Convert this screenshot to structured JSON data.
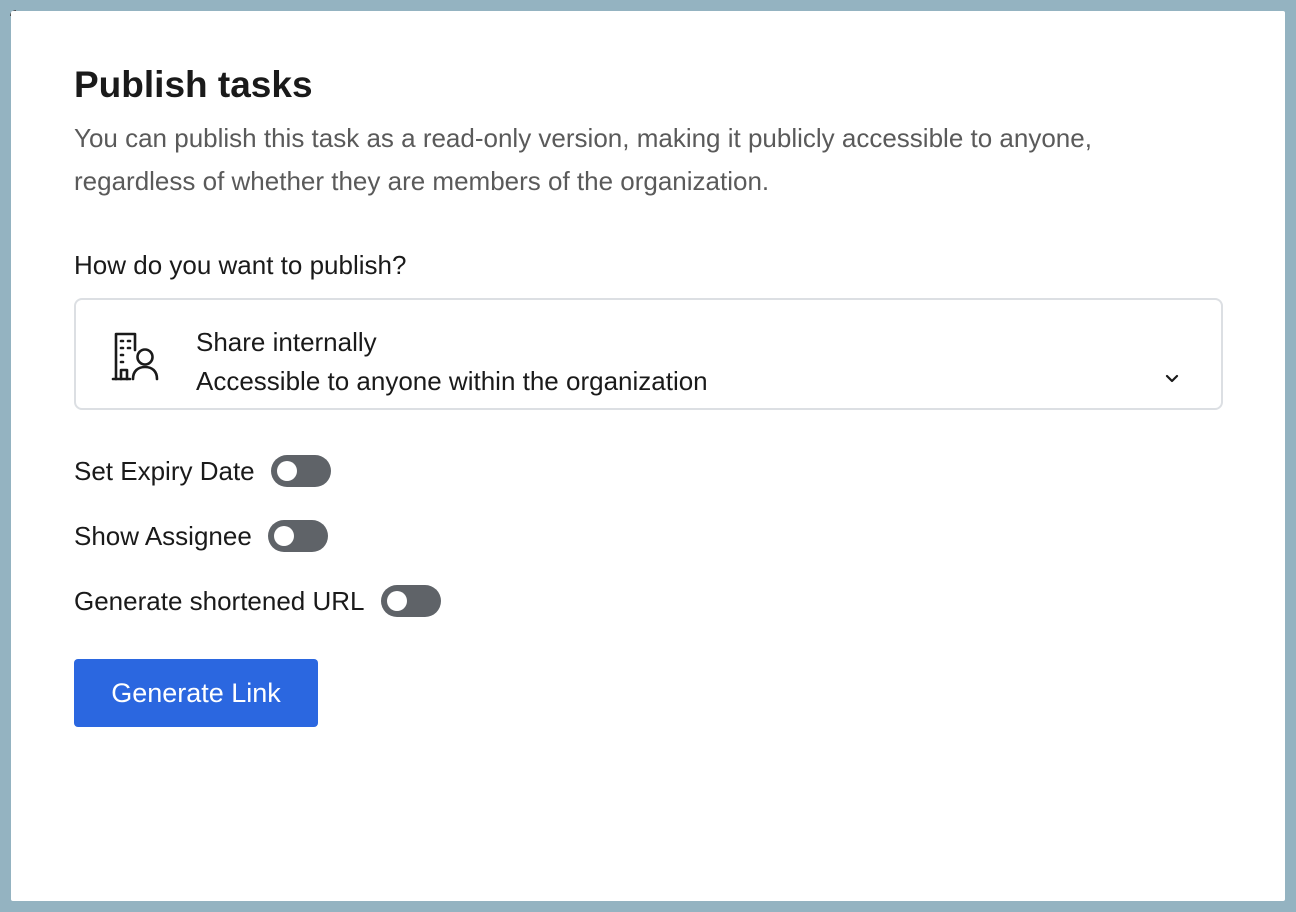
{
  "dialog": {
    "title": "Publish tasks",
    "description": "You can publish this task as a read-only version, making it publicly accessible to anyone, regardless of whether they are members of the organization."
  },
  "publish": {
    "question": "How do you want to publish?",
    "selected_option": {
      "icon": "building-user-icon",
      "title": "Share internally",
      "subtitle": "Accessible to anyone within the organization"
    }
  },
  "toggles": [
    {
      "label": "Set Expiry Date",
      "checked": false
    },
    {
      "label": "Show Assignee",
      "checked": false
    },
    {
      "label": "Generate shortened URL",
      "checked": false
    }
  ],
  "actions": {
    "generate_label": "Generate Link"
  },
  "colors": {
    "backdrop": "#94b3c1",
    "primary": "#2b67e0",
    "toggle_off": "#5f6368",
    "border": "#dcdfe3"
  }
}
